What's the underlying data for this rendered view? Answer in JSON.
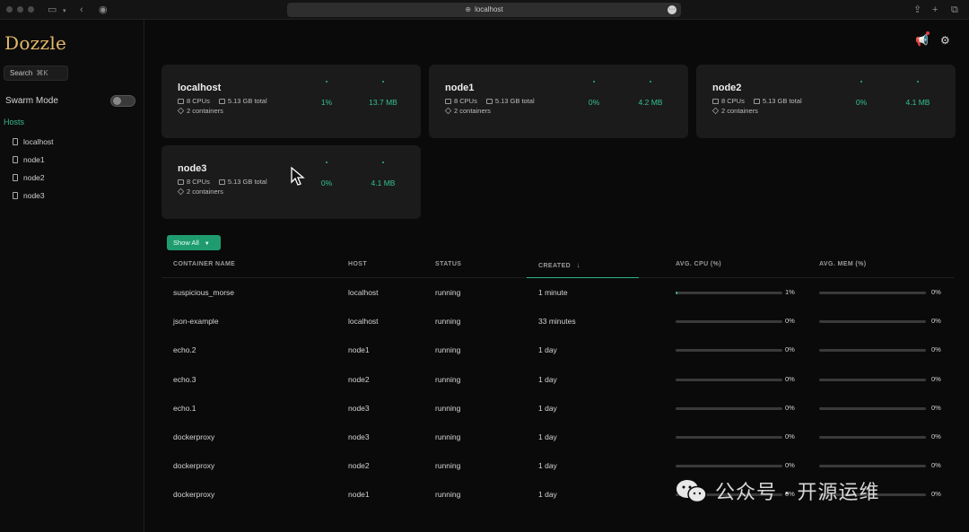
{
  "browser": {
    "url": "localhost"
  },
  "sidebar": {
    "logo": "Dozzle",
    "search_label": "Search",
    "search_shortcut": "⌘K",
    "swarm_mode_label": "Swarm Mode",
    "swarm_mode_on": false,
    "hosts_title": "Hosts",
    "hosts": [
      "localhost",
      "node1",
      "node2",
      "node3"
    ]
  },
  "cards": [
    {
      "name": "localhost",
      "cpus": "8 CPUs",
      "memory": "5.13 GB total",
      "containers": "2 containers",
      "cpu_usage": "1%",
      "mem_usage": "13.7 MB"
    },
    {
      "name": "node1",
      "cpus": "8 CPUs",
      "memory": "5.13 GB total",
      "containers": "2 containers",
      "cpu_usage": "0%",
      "mem_usage": "4.2 MB"
    },
    {
      "name": "node2",
      "cpus": "8 CPUs",
      "memory": "5.13 GB total",
      "containers": "2 containers",
      "cpu_usage": "0%",
      "mem_usage": "4.1 MB"
    },
    {
      "name": "node3",
      "cpus": "8 CPUs",
      "memory": "5.13 GB total",
      "containers": "2 containers",
      "cpu_usage": "0%",
      "mem_usage": "4.1 MB"
    }
  ],
  "filter": {
    "show_all_label": "Show All"
  },
  "table": {
    "headers": {
      "name": "CONTAINER NAME",
      "host": "HOST",
      "status": "STATUS",
      "created": "CREATED",
      "avg_cpu": "AVG. CPU (%)",
      "avg_mem": "AVG. MEM (%)"
    },
    "sort_indicator": "↓",
    "rows": [
      {
        "name": "suspicious_morse",
        "host": "localhost",
        "status": "running",
        "created": "1 minute",
        "cpu": "1%",
        "cpu_value": 1,
        "mem": "0%",
        "mem_value": 0
      },
      {
        "name": "json-example",
        "host": "localhost",
        "status": "running",
        "created": "33 minutes",
        "cpu": "0%",
        "cpu_value": 0,
        "mem": "0%",
        "mem_value": 0
      },
      {
        "name": "echo.2",
        "host": "node1",
        "status": "running",
        "created": "1 day",
        "cpu": "0%",
        "cpu_value": 0,
        "mem": "0%",
        "mem_value": 0
      },
      {
        "name": "echo.3",
        "host": "node2",
        "status": "running",
        "created": "1 day",
        "cpu": "0%",
        "cpu_value": 0,
        "mem": "0%",
        "mem_value": 0
      },
      {
        "name": "echo.1",
        "host": "node3",
        "status": "running",
        "created": "1 day",
        "cpu": "0%",
        "cpu_value": 0,
        "mem": "0%",
        "mem_value": 0
      },
      {
        "name": "dockerproxy",
        "host": "node3",
        "status": "running",
        "created": "1 day",
        "cpu": "0%",
        "cpu_value": 0,
        "mem": "0%",
        "mem_value": 0
      },
      {
        "name": "dockerproxy",
        "host": "node2",
        "status": "running",
        "created": "1 day",
        "cpu": "0%",
        "cpu_value": 0,
        "mem": "0%",
        "mem_value": 0
      },
      {
        "name": "dockerproxy",
        "host": "node1",
        "status": "running",
        "created": "1 day",
        "cpu": "0%",
        "cpu_value": 0,
        "mem": "0%",
        "mem_value": 0
      }
    ]
  },
  "watermark": "公众号 · 开源运维",
  "colors": {
    "accent": "#2fb585",
    "logo": "#e3b86a",
    "background": "#0a0a0a",
    "card": "#1b1b1b"
  }
}
